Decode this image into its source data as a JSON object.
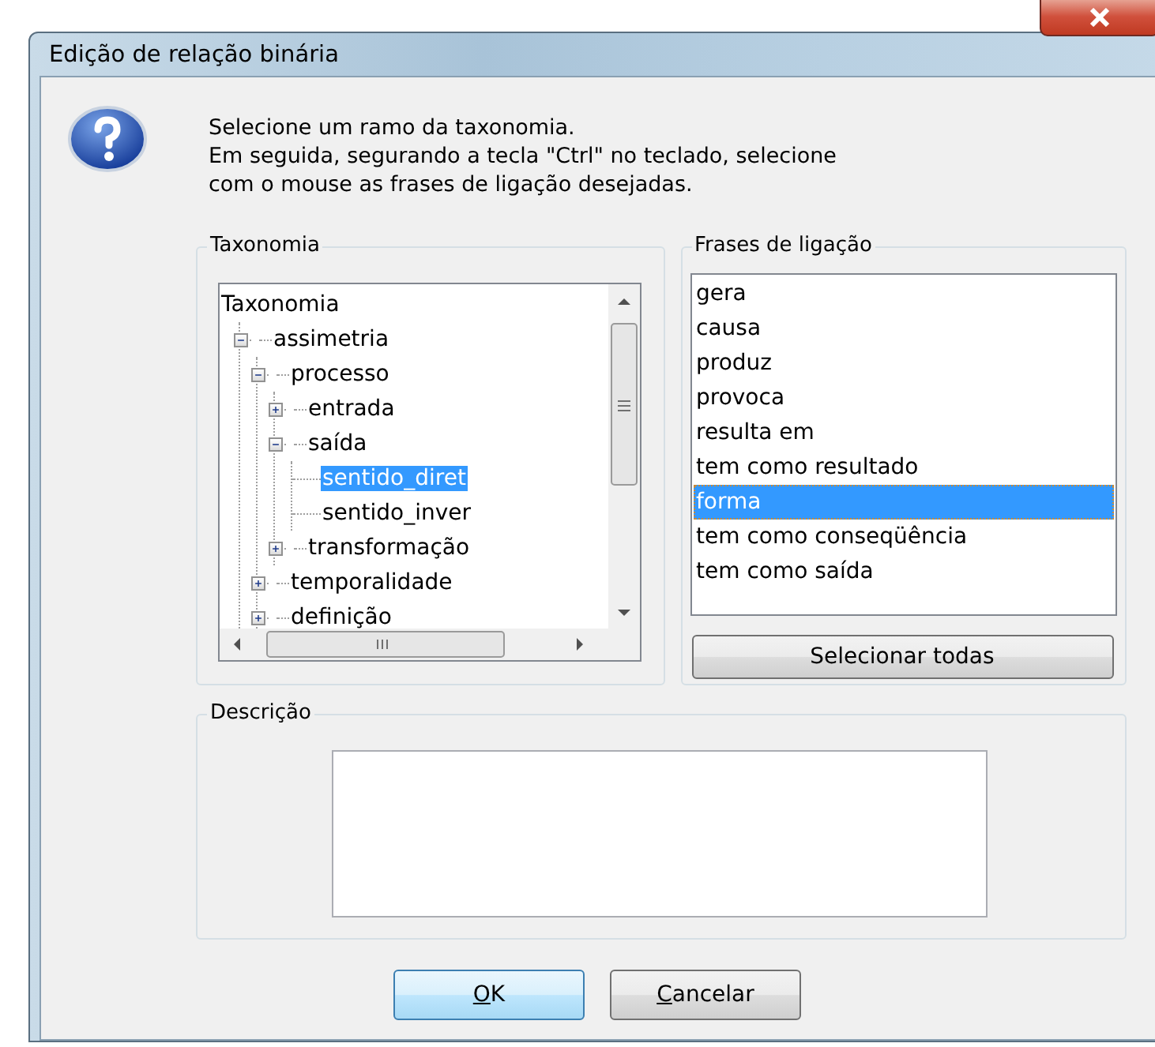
{
  "window": {
    "title": "Edição de relação binária"
  },
  "instructions": [
    "Selecione um ramo da taxonomia.",
    "Em seguida, segurando a tecla \"Ctrl\" no teclado, selecione",
    "com o mouse as frases de ligação desejadas."
  ],
  "taxonomy": {
    "title": "Taxonomia",
    "tree": [
      {
        "label": "Taxonomia",
        "selected": false,
        "children": [
          {
            "label": "assimetria",
            "selected": false,
            "expanded": true,
            "children": [
              {
                "label": "processo",
                "selected": false,
                "expanded": true,
                "children": [
                  {
                    "label": "entrada",
                    "selected": false,
                    "expanded": false
                  },
                  {
                    "label": "saída",
                    "selected": false,
                    "expanded": true,
                    "children": [
                      {
                        "label": "sentido_diret",
                        "selected": true
                      },
                      {
                        "label": "sentido_inver",
                        "selected": false
                      }
                    ]
                  },
                  {
                    "label": "transformação",
                    "selected": false,
                    "expanded": false
                  }
                ]
              },
              {
                "label": "temporalidade",
                "selected": false,
                "expanded": false
              },
              {
                "label": "definição",
                "selected": false,
                "expanded": false
              }
            ]
          }
        ]
      }
    ]
  },
  "linking_phrases": {
    "title": "Frases de ligação",
    "items": [
      {
        "label": "gera",
        "selected": false
      },
      {
        "label": "causa",
        "selected": false
      },
      {
        "label": "produz",
        "selected": false
      },
      {
        "label": "provoca",
        "selected": false
      },
      {
        "label": "resulta em",
        "selected": false
      },
      {
        "label": "tem como resultado",
        "selected": false
      },
      {
        "label": "forma",
        "selected": true
      },
      {
        "label": "tem como conseqüência",
        "selected": false
      },
      {
        "label": "tem como saída",
        "selected": false
      }
    ],
    "select_all_button": "Selecionar todas"
  },
  "description": {
    "title": "Descrição"
  },
  "buttons": [
    {
      "label": "OK",
      "default": true,
      "underline_first": true
    },
    {
      "label": "Cancelar",
      "default": false,
      "underline_first": true
    }
  ]
}
